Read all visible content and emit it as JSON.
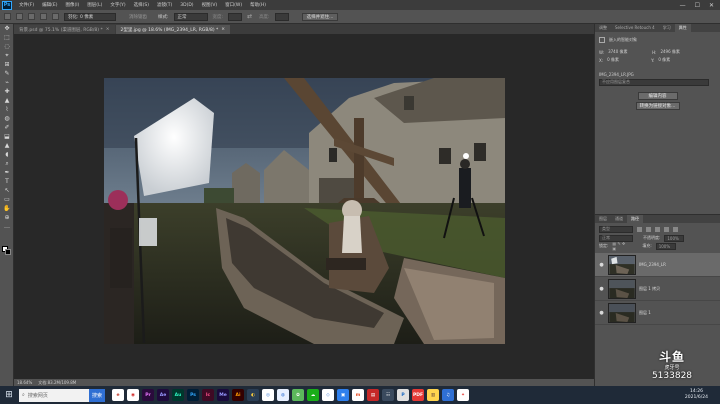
{
  "menubar": {
    "logo": "Ps",
    "items": [
      "文件(F)",
      "编辑(E)",
      "图像(I)",
      "图层(L)",
      "文字(Y)",
      "选择(S)",
      "滤镜(T)",
      "3D(D)",
      "视图(V)",
      "窗口(W)",
      "帮助(H)"
    ],
    "min": "—",
    "max": "☐",
    "close": "✕"
  },
  "options": {
    "feather_label": "羽化: 0 像素",
    "antialias_label": "消除锯齿",
    "style_label": "样式:",
    "style_value": "正常",
    "width_label": "宽度:",
    "height_label": "高度:",
    "select_mask_button": "选择并遮住..."
  },
  "tabs": [
    {
      "label": "背景.psd @ 75.1% (渠道图层, RGB/8) *",
      "close": "×"
    },
    {
      "label": "2型里.jpg @ 18.6% (IMG_2394_LR, RGB/8) *",
      "close": "×"
    }
  ],
  "status": {
    "zoom": "18.64%",
    "doc": "文档:83.2M/109.8M"
  },
  "right_panel": {
    "top_tabs": [
      "调整",
      "Selective Retouch 4",
      "学习",
      "属性"
    ],
    "props_title": "嵌入的智能对象",
    "w_label": "W:",
    "w_value": "3740 像素",
    "h_label": "H:",
    "h_value": "2496 像素",
    "x_label": "X:",
    "x_value": "0 像素",
    "y_label": "Y:",
    "y_value": "0 像素",
    "filename": "IMG_2394_LR.JPG",
    "layer_comp": "不应用图层复合",
    "edit_button": "编辑内容",
    "convert_button": "转换为链接对象...",
    "layer_tabs": [
      "图层",
      "通道",
      "路径"
    ],
    "filter_label": "类型",
    "mode_value": "正常",
    "opacity_label": "不透明度:",
    "opacity_value": "100%",
    "lock_label": "锁定:",
    "fill_label": "填充:",
    "fill_value": "100%",
    "layers": [
      {
        "name": "IMG_2394_LR",
        "selected": true
      },
      {
        "name": "图层 1 拷贝",
        "selected": false
      },
      {
        "name": "图层 1",
        "selected": false
      }
    ]
  },
  "taskbar": {
    "start_icon": "⊞",
    "search_placeholder": "搜索网页",
    "search_button": "搜索",
    "apps": [
      {
        "label": "e",
        "bg": "#ffffff",
        "fg": "#c0392b"
      },
      {
        "label": "◉",
        "bg": "#ffffff",
        "fg": "#d32f2f"
      },
      {
        "label": "Pr",
        "bg": "#2a0b3c",
        "fg": "#ea77ff"
      },
      {
        "label": "Ae",
        "bg": "#1f0b3c",
        "fg": "#9999ff"
      },
      {
        "label": "Au",
        "bg": "#00382d",
        "fg": "#2ef5c2"
      },
      {
        "label": "Ps",
        "bg": "#001e36",
        "fg": "#31a8ff"
      },
      {
        "label": "Ic",
        "bg": "#3f0a24",
        "fg": "#ff4f8b"
      },
      {
        "label": "Me",
        "bg": "#1a0b3c",
        "fg": "#9999ff"
      },
      {
        "label": "Ai",
        "bg": "#330000",
        "fg": "#ff9a00"
      },
      {
        "label": "◐",
        "bg": "#2b3e55",
        "fg": "#ffcf3a"
      },
      {
        "label": "◎",
        "bg": "#ffffff",
        "fg": "#3a7bd5"
      },
      {
        "label": "◍",
        "bg": "#e8f0ff",
        "fg": "#2f6fd3"
      },
      {
        "label": "✿",
        "bg": "#5cb85c",
        "fg": "#ffffff"
      },
      {
        "label": "☁",
        "bg": "#1aad19",
        "fg": "#ffffff"
      },
      {
        "label": "◇",
        "bg": "#ffffff",
        "fg": "#2f6fd3"
      },
      {
        "label": "▣",
        "bg": "#2f80ed",
        "fg": "#ffffff"
      },
      {
        "label": "m",
        "bg": "#ffffff",
        "fg": "#e44d26"
      },
      {
        "label": "▤",
        "bg": "#c62828",
        "fg": "#ffffff"
      },
      {
        "label": "☷",
        "bg": "#3a4a5e",
        "fg": "#ffffff"
      },
      {
        "label": "P",
        "bg": "#e0e0e0",
        "fg": "#1565c0"
      },
      {
        "label": "PDF",
        "bg": "#e53935",
        "fg": "#ffffff"
      },
      {
        "label": "▥",
        "bg": "#ffd54f",
        "fg": "#5d4037"
      },
      {
        "label": "♫",
        "bg": "#2f6fd3",
        "fg": "#ffffff"
      },
      {
        "label": "✦",
        "bg": "#ffffff",
        "fg": "#e53935"
      }
    ],
    "time": "14:26",
    "date": "2021/6/24"
  },
  "watermark": {
    "brand": "斗鱼",
    "sub": "虎牙号",
    "num": "5133828"
  },
  "tools": [
    "✥",
    "⬚",
    "◌",
    "⌖",
    "⊞",
    "✎",
    "⌁",
    "✚",
    "▲",
    "⌇",
    "◍",
    "✐",
    "⬓",
    "▲",
    "◖",
    "⌕",
    "✒",
    "T",
    "↖",
    "▭",
    "✋",
    "⊕",
    "…"
  ]
}
